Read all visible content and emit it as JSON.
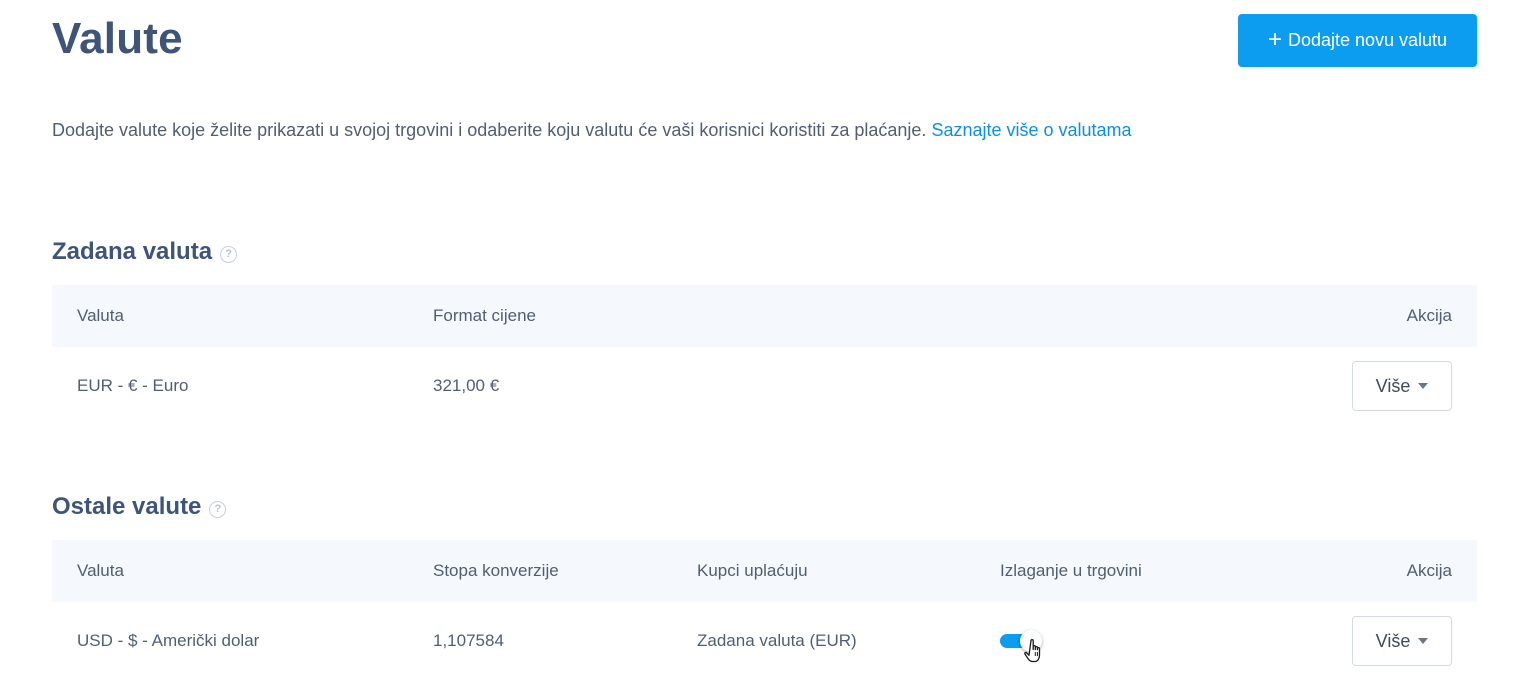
{
  "page": {
    "title": "Valute",
    "add_button_label": "Dodajte novu valutu",
    "add_button_icon": "plus-icon",
    "intro_text": "Dodajte valute koje želite prikazati u svojoj trgovini i odaberite koju valutu će vaši korisnici koristiti za plaćanje.",
    "intro_link": "Saznajte više o valutama",
    "accent_color": "#0c9cf0"
  },
  "default_section": {
    "title": "Zadana valuta",
    "help_icon": "?",
    "columns": {
      "currency": "Valuta",
      "format": "Format cijene",
      "action": "Akcija"
    },
    "row": {
      "currency": "EUR - € - Euro",
      "format": "321,00 €",
      "action_label": "Više"
    }
  },
  "other_section": {
    "title": "Ostale valute",
    "help_icon": "?",
    "columns": {
      "currency": "Valuta",
      "rate": "Stopa konverzije",
      "payment": "Kupci uplaćuju",
      "display": "Izlaganje u trgovini",
      "action": "Akcija"
    },
    "rows": [
      {
        "currency": "USD - $ - Američki dolar",
        "rate": "1,107584",
        "payment": "Zadana valuta (EUR)",
        "display_enabled": true,
        "action_label": "Više"
      }
    ]
  }
}
